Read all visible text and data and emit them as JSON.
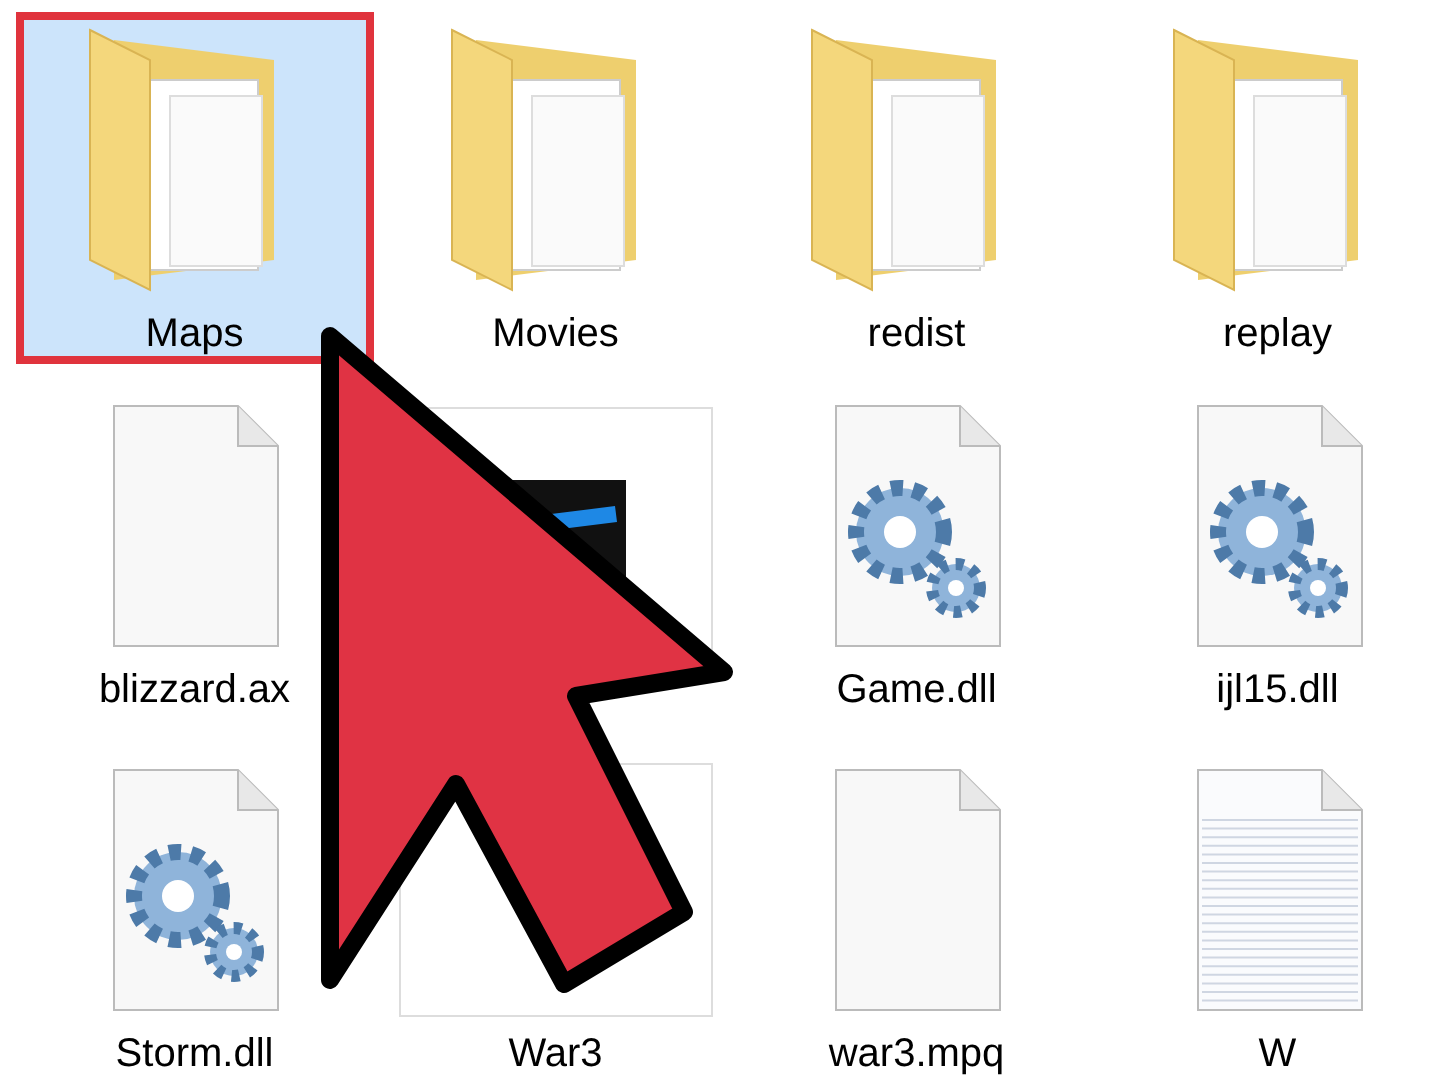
{
  "items": [
    {
      "kind": "folder",
      "label": "Maps",
      "selected": true
    },
    {
      "kind": "folder",
      "label": "Movies",
      "selected": false
    },
    {
      "kind": "folder",
      "label": "redist",
      "selected": false
    },
    {
      "kind": "folder",
      "label": "replay",
      "selected": false
    },
    {
      "kind": "blank",
      "label": "blizzard.ax",
      "selected": false
    },
    {
      "kind": "app",
      "selected": false
    },
    {
      "kind": "gear",
      "label": "Game.dll",
      "selected": false
    },
    {
      "kind": "gear",
      "label": "ijl15.dll",
      "selected": false
    },
    {
      "kind": "gear",
      "label": "Storm.dll",
      "selected": false
    },
    {
      "kind": "frame",
      "label": "War3",
      "selected": false
    },
    {
      "kind": "blank",
      "label": "war3.mpq",
      "selected": false
    },
    {
      "kind": "lined",
      "label": "W",
      "selected": false
    }
  ]
}
